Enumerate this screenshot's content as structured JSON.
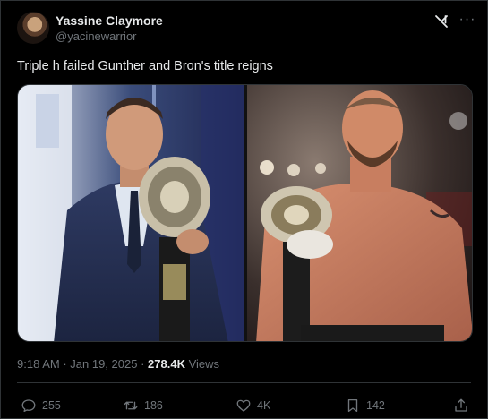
{
  "author": {
    "name": "Yassine Claymore",
    "handle": "@yacinewarrior"
  },
  "tweet": {
    "text": "Triple h failed Gunther and Bron's title reigns"
  },
  "meta": {
    "time": "9:18 AM",
    "separator": " · ",
    "date": "Jan 19, 2025",
    "views_count": "278.4K",
    "views_label": "Views"
  },
  "actions": {
    "replies": "255",
    "reposts": "186",
    "likes": "4K",
    "bookmarks": "142"
  },
  "icons": {
    "grok": "grok-icon",
    "more": "more-icon",
    "reply": "reply-icon",
    "repost": "repost-icon",
    "like": "like-icon",
    "bookmark": "bookmark-icon",
    "share": "share-icon"
  },
  "colors": {
    "background": "#000000",
    "text": "#e7e9ea",
    "secondary": "#71767b",
    "border": "#2f3336"
  }
}
